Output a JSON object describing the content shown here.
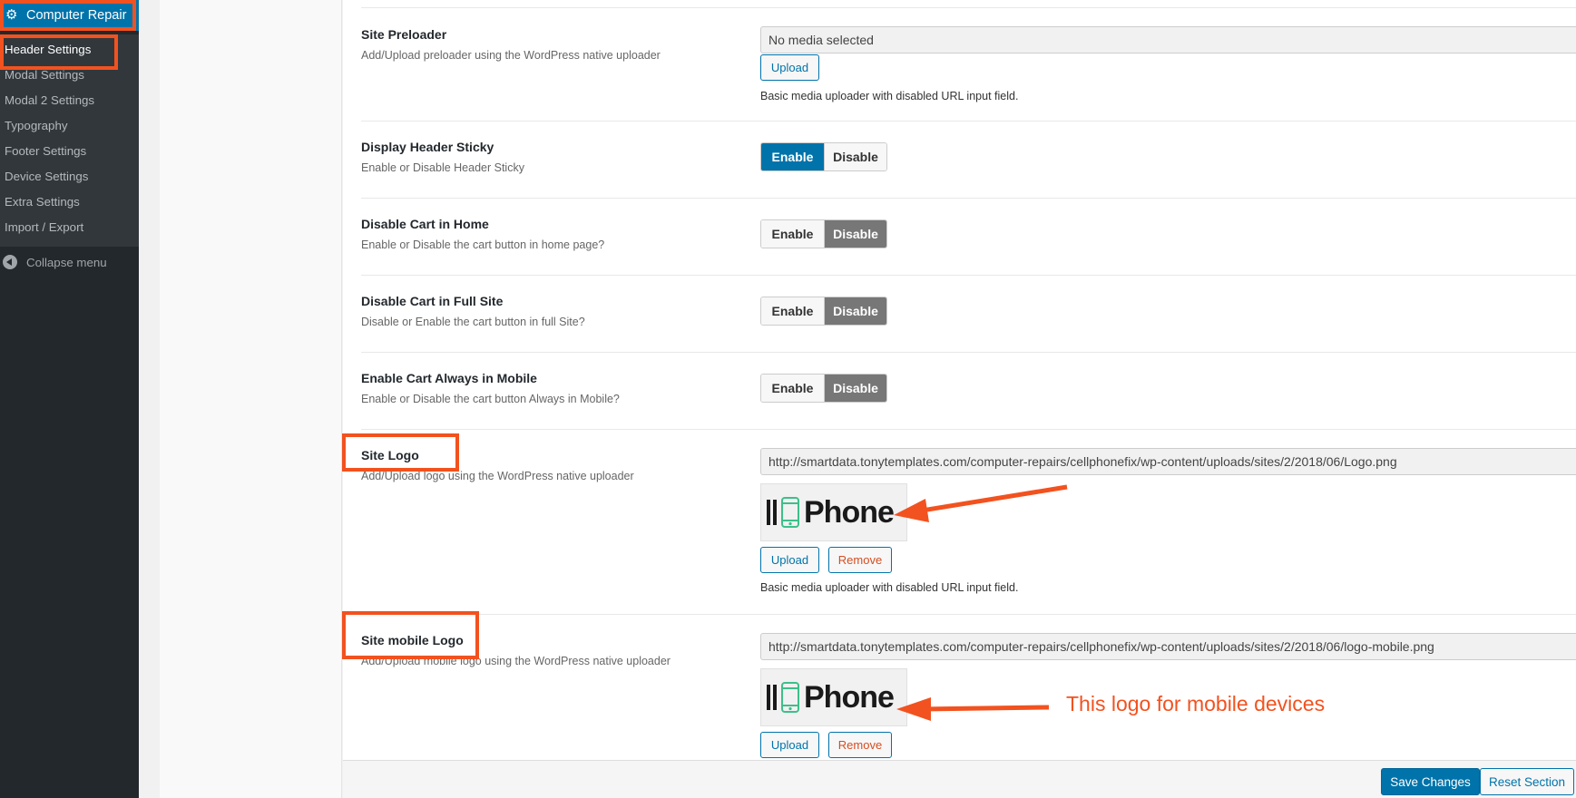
{
  "sidebar": {
    "active_label": "Computer Repair",
    "items": [
      {
        "label": "Header Settings"
      },
      {
        "label": "Modal Settings"
      },
      {
        "label": "Modal 2 Settings"
      },
      {
        "label": "Typography"
      },
      {
        "label": "Footer Settings"
      },
      {
        "label": "Device Settings"
      },
      {
        "label": "Extra Settings"
      },
      {
        "label": "Import / Export"
      }
    ],
    "collapse_label": "Collapse menu"
  },
  "rows": {
    "preloader": {
      "title": "Site Preloader",
      "desc": "Add/Upload preloader using the WordPress native uploader",
      "field_value": "No media selected",
      "upload_label": "Upload",
      "help": "Basic media uploader with disabled URL input field."
    },
    "sticky": {
      "title": "Display Header Sticky",
      "desc": "Enable or Disable Header Sticky",
      "enable": "Enable",
      "disable": "Disable",
      "selected": "Enable"
    },
    "cart_home": {
      "title": "Disable Cart in Home",
      "desc": "Enable or Disable the cart button in home page?",
      "enable": "Enable",
      "disable": "Disable",
      "selected": "Disable"
    },
    "cart_full": {
      "title": "Disable Cart in Full Site",
      "desc": "Disable or Enable the cart button in full Site?",
      "enable": "Enable",
      "disable": "Disable",
      "selected": "Disable"
    },
    "cart_mobile": {
      "title": "Enable Cart Always in Mobile",
      "desc": "Enable or Disable the cart button Always in Mobile?",
      "enable": "Enable",
      "disable": "Disable",
      "selected": "Disable"
    },
    "site_logo": {
      "title": "Site Logo",
      "desc": "Add/Upload logo using the WordPress native uploader",
      "field_value": "http://smartdata.tonytemplates.com/computer-repairs/cellphonefix/wp-content/uploads/sites/2/2018/06/Logo.png",
      "logo_text": "Phone",
      "upload_label": "Upload",
      "remove_label": "Remove",
      "help": "Basic media uploader with disabled URL input field."
    },
    "mobile_logo": {
      "title": "Site mobile Logo",
      "desc": "Add/Upload mobile logo using the WordPress native uploader",
      "field_value": "http://smartdata.tonytemplates.com/computer-repairs/cellphonefix/wp-content/uploads/sites/2/2018/06/logo-mobile.png",
      "logo_text": "Phone",
      "upload_label": "Upload",
      "remove_label": "Remove",
      "annotation": "This logo for mobile devices"
    }
  },
  "footer": {
    "save_label": "Save Changes",
    "reset_label": "Reset Section"
  },
  "colors": {
    "accent": "#0073aa",
    "highlight": "#f2521f",
    "sidebar_bg": "#23282d"
  }
}
